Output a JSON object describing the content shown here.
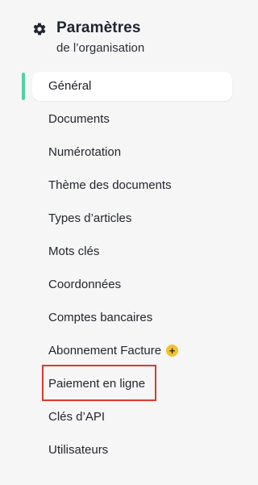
{
  "header": {
    "icon": "gear-icon",
    "title": "Paramètres",
    "subtitle": "de l’organisation"
  },
  "colors": {
    "background": "#f6f6f7",
    "active_indicator": "#4fd1a5",
    "badge": "#f2c12e",
    "highlight_border": "#e0392b"
  },
  "nav": {
    "items": [
      {
        "label": "Général",
        "active": true
      },
      {
        "label": "Documents"
      },
      {
        "label": "Numérotation"
      },
      {
        "label": "Thème des documents"
      },
      {
        "label": "Types d’articles"
      },
      {
        "label": "Mots clés"
      },
      {
        "label": "Coordonnées"
      },
      {
        "label": "Comptes bancaires"
      },
      {
        "label": "Abonnement Facture",
        "badge": "+",
        "badge_icon": "plus-badge-icon"
      },
      {
        "label": "Paiement en ligne",
        "highlighted": true
      },
      {
        "label": "Clés d’API"
      },
      {
        "label": "Utilisateurs"
      }
    ]
  }
}
